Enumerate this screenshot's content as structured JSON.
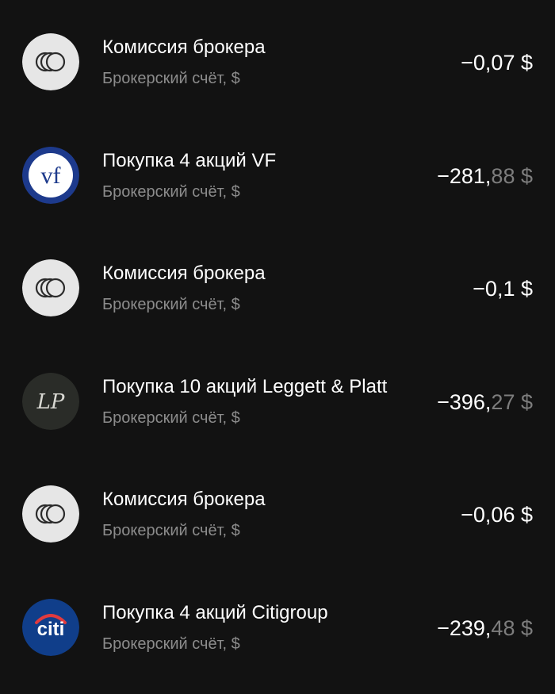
{
  "colors": {
    "background": "#121212",
    "title": "#ffffff",
    "subtitle": "#8c8c8c",
    "amount_dim": "#7d7d7d",
    "commission_avatar_bg": "#e6e6e6",
    "vf_avatar_bg": "#1d3a8c",
    "lp_avatar_bg": "#2a2c28",
    "citi_avatar_bg": "#103e8a",
    "citi_arc": "#e03a3e"
  },
  "transactions": [
    {
      "icon": "coins-icon",
      "title": "Комиссия брокера",
      "account": "Брокерский счёт, $",
      "amount_int": "−0,07",
      "amount_frac": "",
      "currency": " $",
      "all_bright": true
    },
    {
      "icon": "vf-logo-icon",
      "logo_text": "vf",
      "title": "Покупка 4 акций VF",
      "account": "Брокерский счёт, $",
      "amount_int": "−281,",
      "amount_frac": "88",
      "currency": " $",
      "all_bright": false
    },
    {
      "icon": "coins-icon",
      "title": "Комиссия брокера",
      "account": "Брокерский счёт, $",
      "amount_int": "−0,1",
      "amount_frac": "",
      "currency": " $",
      "all_bright": true
    },
    {
      "icon": "leggett-platt-logo-icon",
      "logo_text": "LP",
      "title": "Покупка 10 акций Leggett & Platt",
      "account": "Брокерский счёт, $",
      "amount_int": "−396,",
      "amount_frac": "27",
      "currency": " $",
      "all_bright": false
    },
    {
      "icon": "coins-icon",
      "title": "Комиссия брокера",
      "account": "Брокерский счёт, $",
      "amount_int": "−0,06",
      "amount_frac": "",
      "currency": " $",
      "all_bright": true
    },
    {
      "icon": "citi-logo-icon",
      "logo_text": "citi",
      "title": "Покупка 4 акций Citigroup",
      "account": "Брокерский счёт, $",
      "amount_int": "−239,",
      "amount_frac": "48",
      "currency": " $",
      "all_bright": false
    }
  ]
}
